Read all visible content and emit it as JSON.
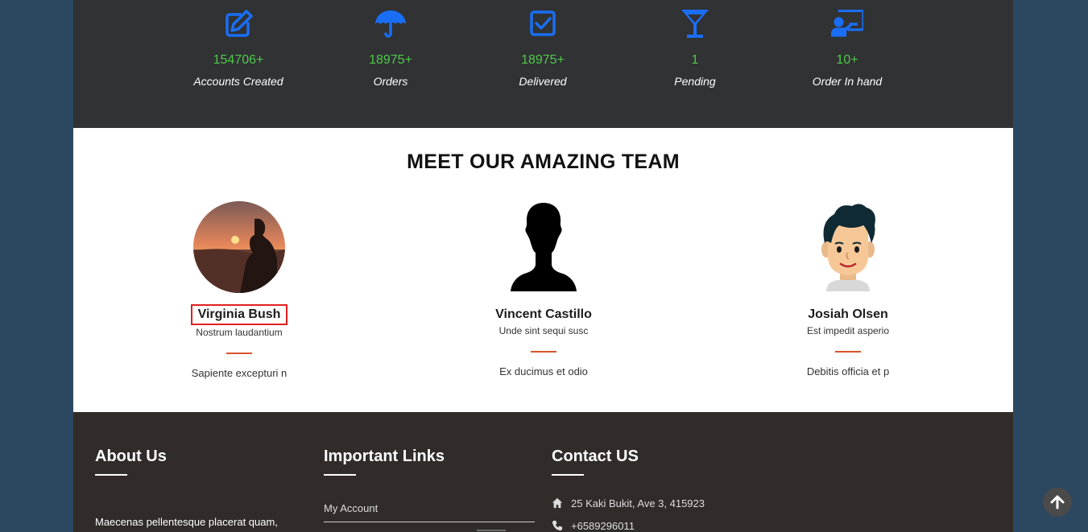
{
  "stats": [
    {
      "icon": "edit-icon",
      "value": "154706+",
      "label": "Accounts Created"
    },
    {
      "icon": "umbrella-icon",
      "value": "18975+",
      "label": "Orders"
    },
    {
      "icon": "checkbox-icon",
      "value": "18975+",
      "label": "Delivered"
    },
    {
      "icon": "cocktail-icon",
      "value": "1",
      "label": "Pending"
    },
    {
      "icon": "presenter-icon",
      "value": "10+",
      "label": "Order In hand"
    }
  ],
  "colors": {
    "stat_icon": "#1a6ef5",
    "stat_value": "#4fc94a",
    "accent_line": "#d9542b",
    "selection": "#e02020"
  },
  "team": {
    "title": "MEET OUR AMAZING TEAM",
    "members": [
      {
        "name": "Virginia Bush",
        "role": "Nostrum laudantium",
        "desc": "Sapiente excepturi n",
        "avatar": "sunset-photo-avatar"
      },
      {
        "name": "Vincent Castillo",
        "role": "Unde sint sequi susc",
        "desc": "Ex ducimus et odio",
        "avatar": "silhouette-avatar"
      },
      {
        "name": "Josiah Olsen",
        "role": "Est impedit asperio",
        "desc": "Debitis officia et p",
        "avatar": "cartoon-man-avatar"
      }
    ]
  },
  "footer": {
    "about": {
      "heading": "About Us",
      "text": "Maecenas pellentesque placerat quam,"
    },
    "links": {
      "heading": "Important Links",
      "items": [
        "My Account"
      ]
    },
    "contact": {
      "heading": "Contact US",
      "address": "25 Kaki Bukit, Ave 3, 415923",
      "phone": "+6589296011"
    }
  }
}
